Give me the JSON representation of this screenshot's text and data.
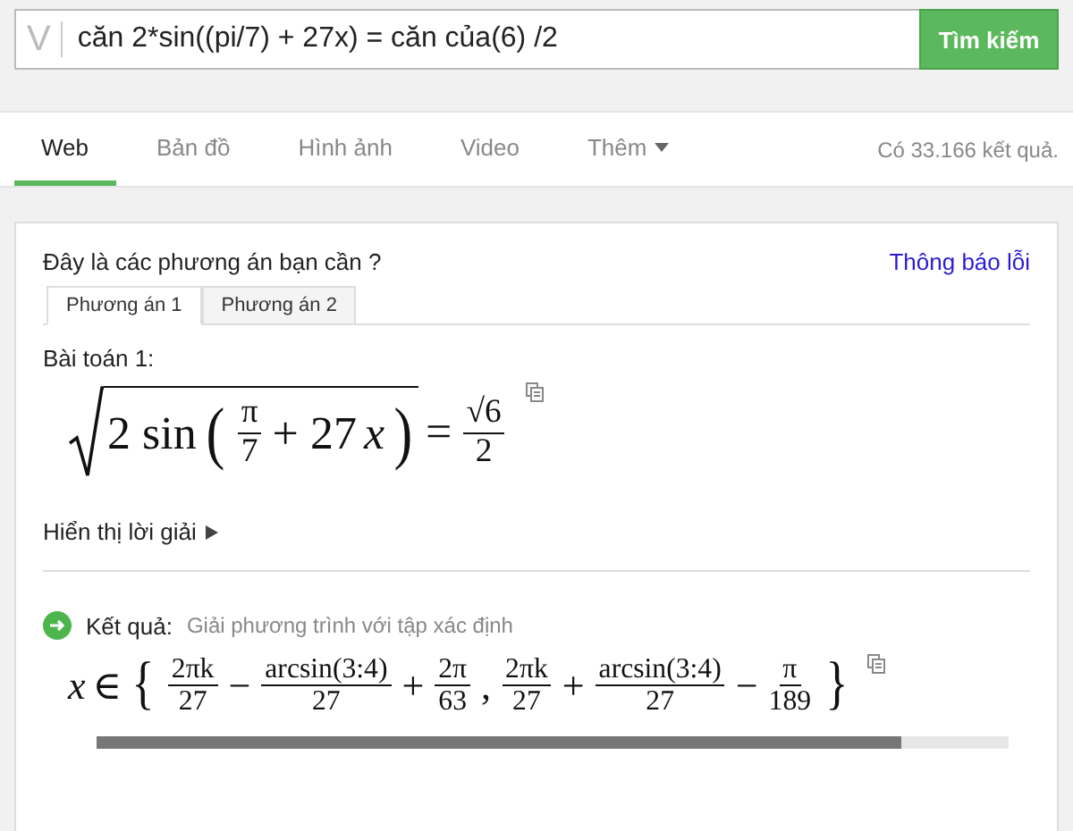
{
  "search": {
    "logo": "V",
    "value": "căn 2*sin((pi/7) + 27x) = căn của(6) /2",
    "button": "Tìm kiếm"
  },
  "nav": {
    "tabs": [
      {
        "label": "Web",
        "selected": true,
        "dropdown": false
      },
      {
        "label": "Bản đồ",
        "selected": false,
        "dropdown": false
      },
      {
        "label": "Hình ảnh",
        "selected": false,
        "dropdown": false
      },
      {
        "label": "Video",
        "selected": false,
        "dropdown": false
      },
      {
        "label": "Thêm",
        "selected": false,
        "dropdown": true
      }
    ],
    "result_count": "Có 33.166 kết quả."
  },
  "card": {
    "question": "Đây là các phương án bạn cần ?",
    "report_link": "Thông báo lỗi",
    "tabs": [
      {
        "label": "Phương án 1",
        "selected": true
      },
      {
        "label": "Phương án 2",
        "selected": false
      }
    ],
    "problem_title": "Bài toán 1:",
    "problem_formula": [
      {
        "kind": "sqrt",
        "children": [
          {
            "kind": "text",
            "text": "2 sin"
          },
          {
            "kind": "big",
            "text": "("
          },
          {
            "kind": "frac",
            "num": "π",
            "den": "7"
          },
          {
            "kind": "text",
            "text": "+ 27"
          },
          {
            "kind": "var",
            "text": "x"
          },
          {
            "kind": "big",
            "text": ")"
          }
        ]
      },
      {
        "kind": "text",
        "text": "="
      },
      {
        "kind": "frac",
        "num": "√6",
        "den": "2"
      }
    ],
    "show_solution": "Hiển thị lời giải",
    "result_label": "Kết quả:",
    "result_desc": "Giải phương trình với tập xác định",
    "result_formula": [
      {
        "kind": "var",
        "text": "x"
      },
      {
        "kind": "text",
        "text": "∈"
      },
      {
        "kind": "big",
        "text": "{"
      },
      {
        "kind": "frac",
        "num": "2πk",
        "den": "27"
      },
      {
        "kind": "text",
        "text": "−"
      },
      {
        "kind": "frac",
        "num": "arcsin(3:4)",
        "den": "27"
      },
      {
        "kind": "text",
        "text": "+"
      },
      {
        "kind": "frac",
        "num": "2π",
        "den": "63"
      },
      {
        "kind": "text",
        "text": ","
      },
      {
        "kind": "frac",
        "num": "2πk",
        "den": "27"
      },
      {
        "kind": "text",
        "text": "+"
      },
      {
        "kind": "frac",
        "num": "arcsin(3:4)",
        "den": "27"
      },
      {
        "kind": "text",
        "text": "−"
      },
      {
        "kind": "frac",
        "num": "π",
        "den": "189"
      },
      {
        "kind": "big",
        "text": "}"
      }
    ]
  }
}
